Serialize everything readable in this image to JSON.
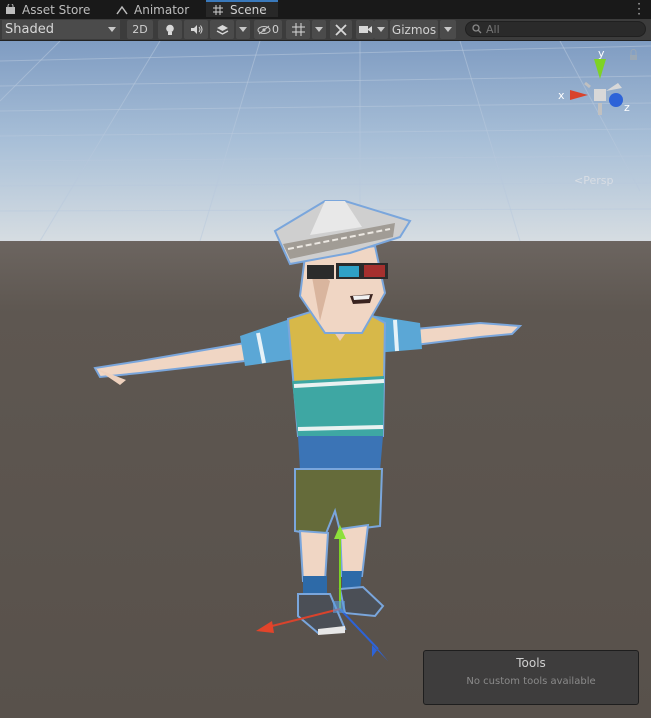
{
  "tabs": [
    {
      "label": "Asset Store",
      "icon": "shopping-bag-icon"
    },
    {
      "label": "Animator",
      "icon": "animator-icon"
    },
    {
      "label": "Scene",
      "icon": "grid-hash-icon",
      "active": true
    }
  ],
  "toolbar": {
    "draw_mode": "Shaded",
    "toggle_2d": "2D",
    "hidden_count": "0",
    "gizmos_label": "Gizmos",
    "search_placeholder": "All"
  },
  "scene": {
    "projection_label": "Persp",
    "gizmo_axes": {
      "x": "x",
      "y": "y",
      "z": "z"
    }
  },
  "tools_overlay": {
    "title": "Tools",
    "message": "No custom tools available"
  },
  "colors": {
    "x_axis": "#d8432c",
    "y_axis": "#7ed324",
    "z_axis": "#2d63d8",
    "selection_outline": "#6f9fd6",
    "sky_top": "#7e9bc0",
    "ground": "#5a534d"
  }
}
